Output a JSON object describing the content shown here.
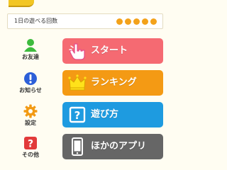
{
  "header": {
    "plays_label": "1日の遊べる回数",
    "plays_remaining": 5
  },
  "colors": {
    "coin": "#f3a21a",
    "start": "#f56a72",
    "ranking": "#f49a14",
    "howto": "#1e9be0",
    "other": "#666666"
  },
  "side": [
    {
      "label": "お友達",
      "icon": "friend-icon"
    },
    {
      "label": "お知らせ",
      "icon": "info-icon"
    },
    {
      "label": "設定",
      "icon": "gear-icon"
    },
    {
      "label": "その他",
      "icon": "question-icon"
    }
  ],
  "buttons": {
    "start": "スタート",
    "ranking": "ランキング",
    "howto": "遊び方",
    "other_apps": "ほかのアプリ"
  },
  "icons": {
    "howto_glyph": "?",
    "other_glyph": "?"
  }
}
